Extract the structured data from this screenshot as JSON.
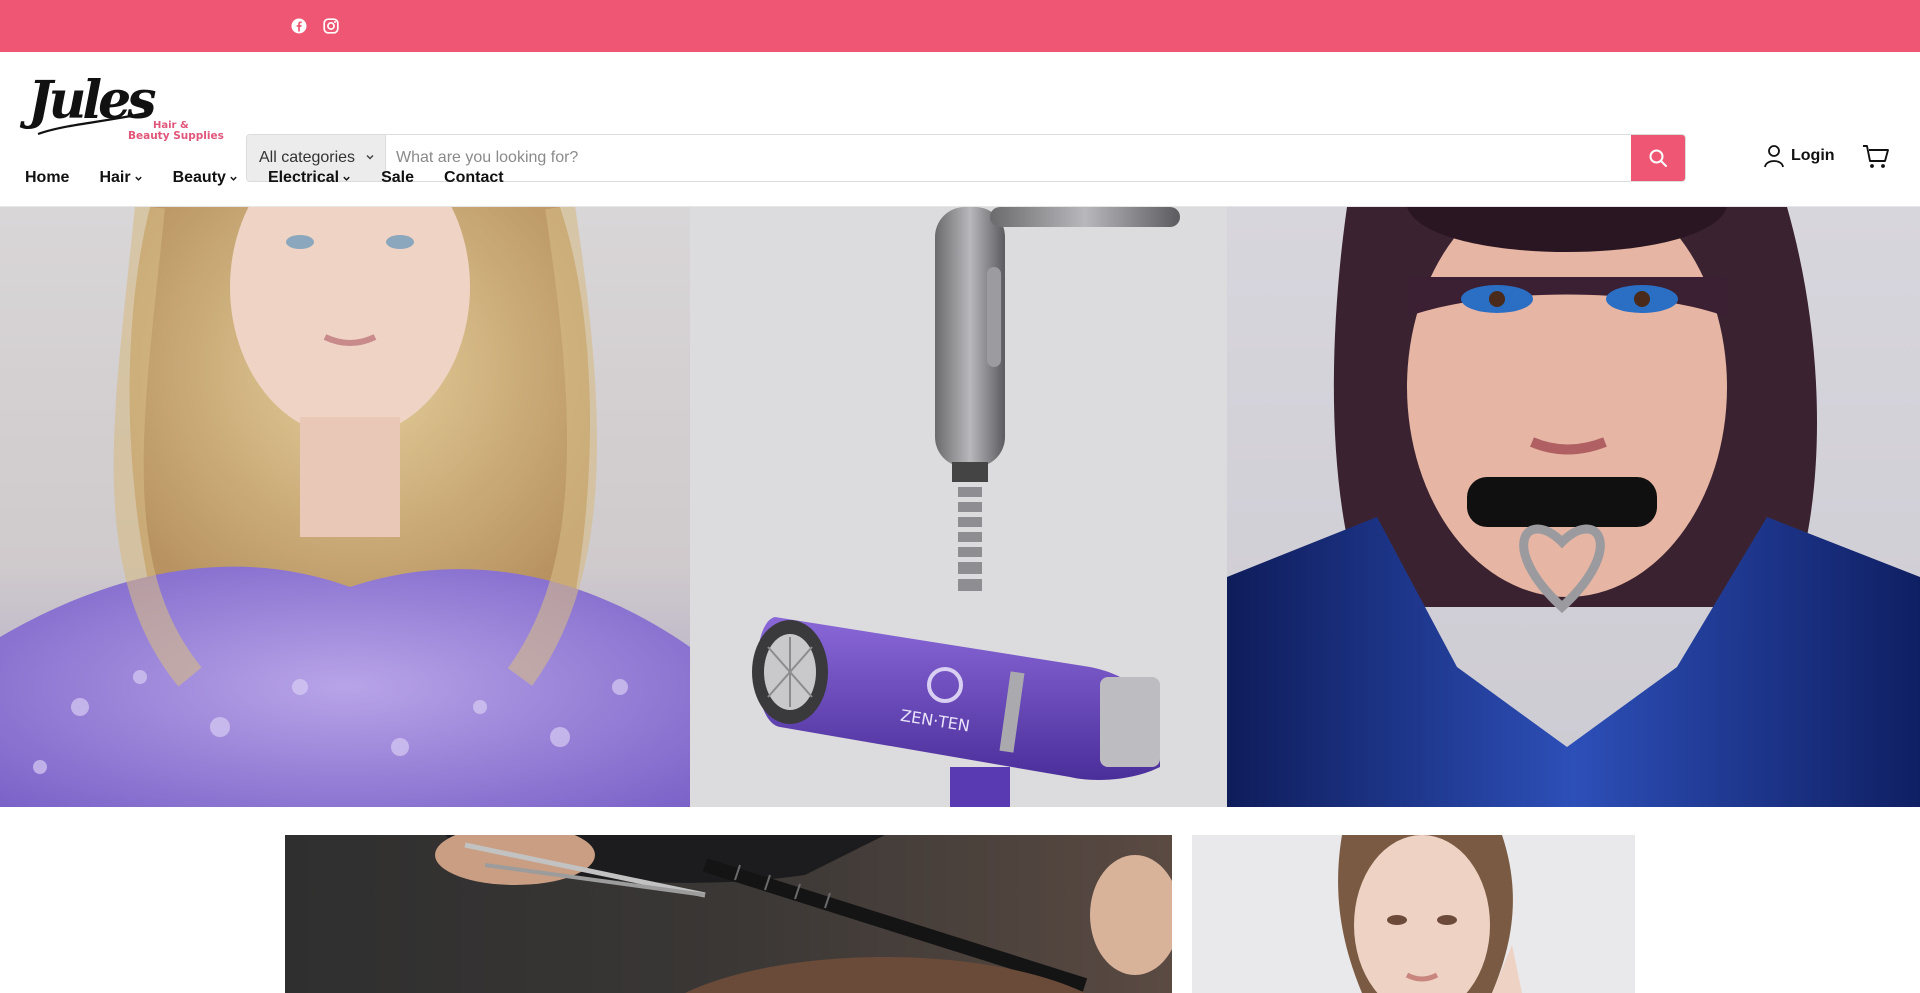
{
  "topbar": {
    "color": "#ee5673",
    "social": [
      {
        "icon": "facebook-icon"
      },
      {
        "icon": "instagram-icon"
      }
    ]
  },
  "header": {
    "logo": {
      "script": "Jules",
      "tagline_line1": "Hair &",
      "tagline_line2": "Beauty Supplies",
      "tagline_color": "#e0557a"
    },
    "search": {
      "category_label": "All categories",
      "placeholder": "What are you looking for?",
      "value": "",
      "button_icon": "search-icon",
      "button_color": "#ee5673"
    },
    "login_label": "Login",
    "cart_icon": "cart-icon"
  },
  "nav": {
    "items": [
      {
        "label": "Home",
        "dropdown": false
      },
      {
        "label": "Hair",
        "dropdown": true
      },
      {
        "label": "Beauty",
        "dropdown": true
      },
      {
        "label": "Electrical",
        "dropdown": true
      },
      {
        "label": "Sale",
        "dropdown": false
      },
      {
        "label": "Contact",
        "dropdown": false
      }
    ]
  },
  "hero": {
    "panels": [
      {
        "subject": "blonde-model-photo"
      },
      {
        "subject": "hair-dryer-product-photo",
        "product_text": "ZEN·TEN"
      },
      {
        "subject": "dark-hair-model-photo"
      }
    ]
  },
  "tiles": [
    {
      "subject": "hair-cutting-photo"
    },
    {
      "subject": "skincare-model-photo"
    }
  ]
}
